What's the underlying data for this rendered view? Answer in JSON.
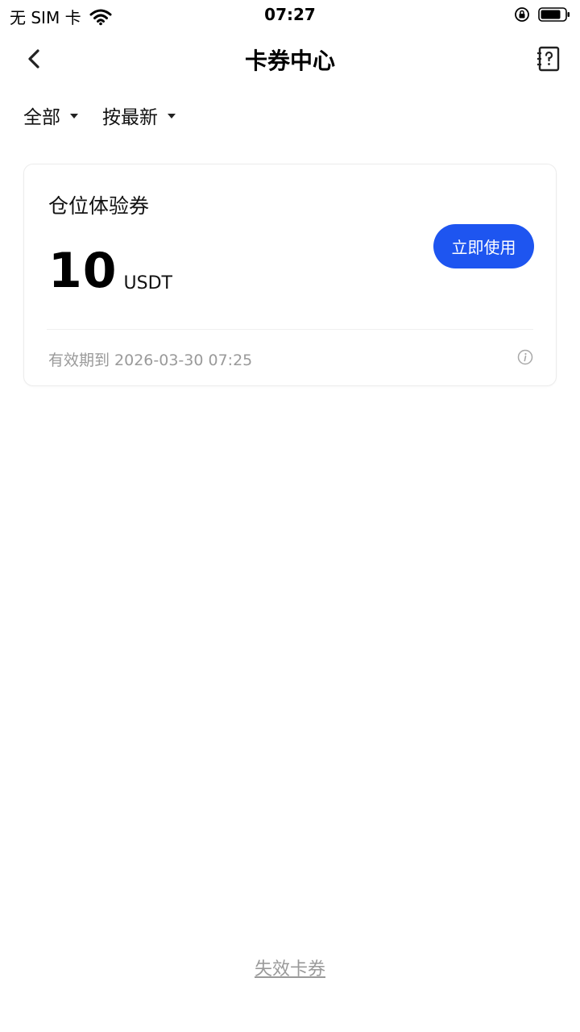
{
  "status_bar": {
    "carrier": "无 SIM 卡",
    "time": "07:27"
  },
  "nav": {
    "title": "卡券中心"
  },
  "filters": [
    {
      "label": "全部"
    },
    {
      "label": "按最新"
    }
  ],
  "coupon": {
    "title": "仓位体验券",
    "amount": "10",
    "unit": "USDT",
    "action_label": "立即使用",
    "expiry": "有效期到 2026-03-30 07:25"
  },
  "footer": {
    "expired_link": "失效卡券"
  },
  "colors": {
    "accent": "#1e55f0",
    "muted_text": "#9a9a9a"
  }
}
